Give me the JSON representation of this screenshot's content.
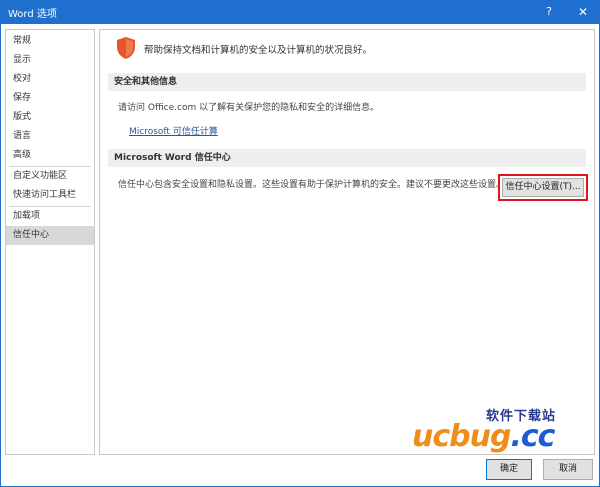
{
  "window": {
    "title": "Word 选项",
    "help_label": "?",
    "close_label": "✕"
  },
  "sidebar": {
    "items": [
      {
        "label": "常规"
      },
      {
        "label": "显示"
      },
      {
        "label": "校对"
      },
      {
        "label": "保存"
      },
      {
        "label": "版式"
      },
      {
        "label": "语言"
      },
      {
        "label": "高级"
      },
      {
        "label": "自定义功能区"
      },
      {
        "label": "快速访问工具栏"
      },
      {
        "label": "加载项"
      },
      {
        "label": "信任中心"
      }
    ],
    "active": "信任中心"
  },
  "main": {
    "header": "帮助保持文档和计算机的安全以及计算机的状况良好。",
    "security": {
      "section_title": "安全和其他信息",
      "description": "请访问 Office.com 以了解有关保护您的隐私和安全的详细信息。",
      "link": "Microsoft 可信任计算"
    },
    "trust_center": {
      "section_title": "Microsoft Word 信任中心",
      "description": "信任中心包含安全设置和隐私设置。这些设置有助于保护计算机的安全。建议不要更改这些设置。",
      "settings_button": "信任中心设置(T)..."
    }
  },
  "footer": {
    "ok_label": "确定",
    "cancel_label": "取消"
  },
  "watermark": {
    "cn_text": "软件下载站",
    "logo_main": "ucbug",
    "logo_suffix": ".cc"
  },
  "colors": {
    "titlebar": "#1e6fce",
    "highlight": "#e0141c",
    "link": "#2b579a",
    "shield": "#e8542c"
  }
}
